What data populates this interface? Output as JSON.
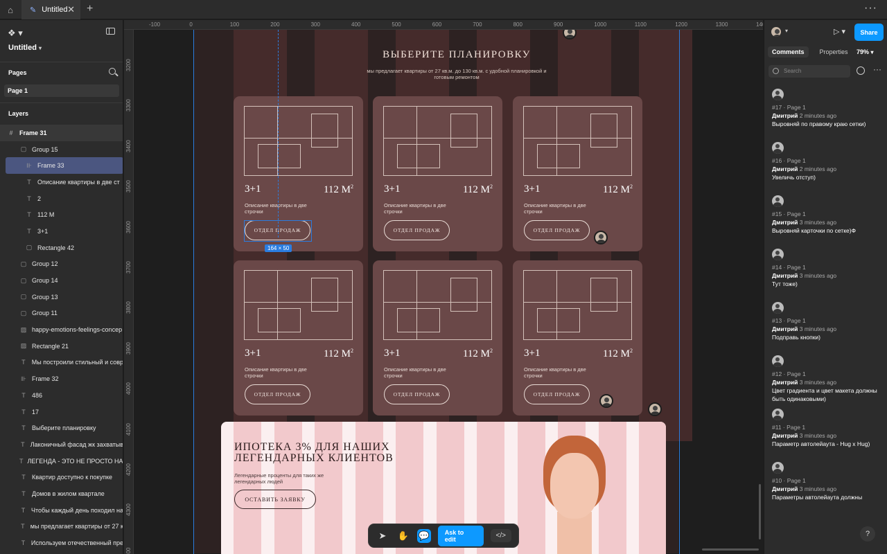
{
  "tabbar": {
    "tab_title": "Untitled",
    "close": "✕",
    "new_tab": "+",
    "more": "···"
  },
  "left_panel": {
    "file_title": "Untitled",
    "pages_header": "Pages",
    "page": "Page 1",
    "layers_header": "Layers",
    "layers": [
      {
        "name": "Frame 31",
        "icon": "#"
      },
      {
        "name": "Group 15",
        "icon": "▢"
      },
      {
        "name": "Frame 33",
        "icon": "⊪"
      },
      {
        "name": "Описание квартиры в две ст",
        "icon": "T"
      },
      {
        "name": "2",
        "icon": "T"
      },
      {
        "name": "112 M",
        "icon": "T"
      },
      {
        "name": "3+1",
        "icon": "T"
      },
      {
        "name": "Rectangle 42",
        "icon": "▢"
      },
      {
        "name": "Group 12",
        "icon": "▢"
      },
      {
        "name": "Group 14",
        "icon": "▢"
      },
      {
        "name": "Group 13",
        "icon": "▢"
      },
      {
        "name": "Group 11",
        "icon": "▢"
      },
      {
        "name": "happy-emotions-feelings-concep",
        "icon": "▨"
      },
      {
        "name": "Rectangle 21",
        "icon": "▨"
      },
      {
        "name": "Мы построили стильный и совр",
        "icon": "T"
      },
      {
        "name": "Frame 32",
        "icon": "⊪"
      },
      {
        "name": "486",
        "icon": "T"
      },
      {
        "name": "17",
        "icon": "T"
      },
      {
        "name": "Выберите планировку",
        "icon": "T"
      },
      {
        "name": "Лаконичный фасад жк захватыв",
        "icon": "T"
      },
      {
        "name": "ЛЕГЕНДА - ЭТО НЕ ПРОСТО НАЗ",
        "icon": "T"
      },
      {
        "name": "Квартир доступно к покупке",
        "icon": "T"
      },
      {
        "name": "Домов в жилом квартале",
        "icon": "T"
      },
      {
        "name": "Чтобы каждый день походил на",
        "icon": "T"
      },
      {
        "name": "мы предлагает квартиры от 27 к",
        "icon": "T"
      },
      {
        "name": "Используем отечественный пре",
        "icon": "T"
      }
    ]
  },
  "ruler": {
    "top": [
      "-100",
      "0",
      "100",
      "200",
      "300",
      "400",
      "500",
      "600",
      "700",
      "800",
      "900",
      "1000",
      "1100",
      "1200",
      "1300",
      "140"
    ],
    "left": [
      "3200",
      "3300",
      "3400",
      "3500",
      "3600",
      "3700",
      "3800",
      "3900",
      "4000",
      "4100",
      "4200",
      "4300",
      "400"
    ]
  },
  "design": {
    "title": "ВЫБЕРИТЕ ПЛАНИРОВКУ",
    "subtitle": "мы предлагает квартиры от 27 кв.м. до 130 кв.м. с удобной планировкой и готовым ремонтом",
    "card": {
      "rooms": "3+1",
      "area": "112 M",
      "area_sup": "2",
      "desc": "Описание квартиры в две строчки",
      "button": "ОТДЕЛ ПРОДАЖ"
    },
    "selection_size": "164 × 50",
    "banner": {
      "title_line1": "ИПОТЕКА 3% ДЛЯ НАШИХ",
      "title_line2": "ЛЕГЕНДАРНЫХ КЛИЕНТОВ",
      "subtitle": "Легендарные проценты для таких же легендарных людей",
      "button": "ОСТАВИТЬ ЗАЯВКУ"
    }
  },
  "toolbar": {
    "ask": "Ask to edit",
    "code": "</>"
  },
  "right_panel": {
    "share": "Share",
    "tabs": [
      "Comments",
      "Properties"
    ],
    "zoom": "79%",
    "search_placeholder": "Search",
    "comments": [
      {
        "meta": "#17 · Page 1",
        "author": "Дмитрий",
        "time": "2 minutes ago",
        "text": "Выровняй по правому краю сетки)"
      },
      {
        "meta": "#16 · Page 1",
        "author": "Дмитрий",
        "time": "2 minutes ago",
        "text": "Увеличь отступ)"
      },
      {
        "meta": "#15 · Page 1",
        "author": "Дмитрий",
        "time": "3 minutes ago",
        "text": "Выровняй карточки по сетке)Ф"
      },
      {
        "meta": "#14 · Page 1",
        "author": "Дмитрий",
        "time": "3 minutes ago",
        "text": "Тут тоже)"
      },
      {
        "meta": "#13 · Page 1",
        "author": "Дмитрий",
        "time": "3 minutes ago",
        "text": "Подправь кнопки)"
      },
      {
        "meta": "#12 · Page 1",
        "author": "Дмитрий",
        "time": "3 minutes ago",
        "text": "Цвет градиента и цвет макета должны быть одинаковыми)"
      },
      {
        "meta": "#11 · Page 1",
        "author": "Дмитрий",
        "time": "3 minutes ago",
        "text": "Параметр автолейаута - Hug x Hug)"
      },
      {
        "meta": "#10 · Page 1",
        "author": "Дмитрий",
        "time": "3 minutes ago",
        "text": "Параметры автолейаута должны"
      }
    ],
    "help": "?"
  },
  "colors": {
    "accent": "#0d99ff",
    "guide": "#2b7de0",
    "card": "#6a4848",
    "banner": "#fbeff0"
  }
}
